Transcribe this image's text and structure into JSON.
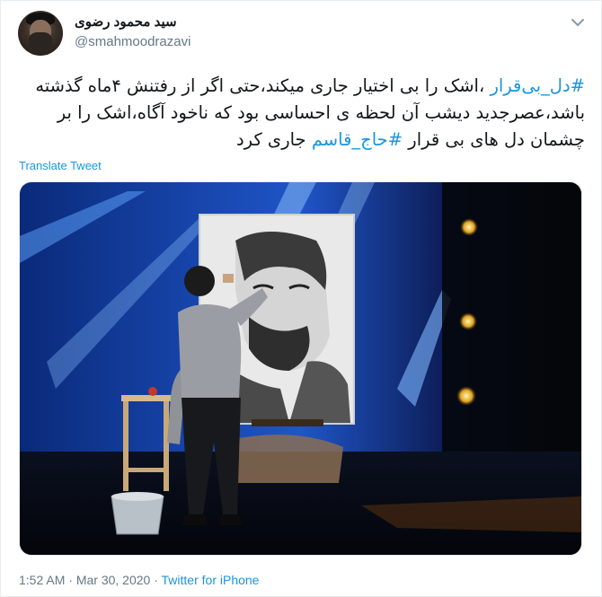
{
  "user": {
    "display_name": "سید محمود رضوی",
    "handle": "@smahmoodrazavi"
  },
  "tweet": {
    "hashtag1": "#دل_بی‌قرار",
    "part1": " ،اشک را بی اختیار جاری میکند،حتی اگر از رفتنش ۴ماه گذشته باشد،عصرجدید دیشب آن لحظه ی احساسی بود که ناخود آگاه،اشک را بر چشمان دل های بی قرار ",
    "hashtag2": "#حاج_قاسم",
    "part2": " جاری کرد"
  },
  "translate_label": "Translate Tweet",
  "meta": {
    "time": "1:52 AM",
    "sep": " · ",
    "date": "Mar 30, 2020",
    "source": "Twitter for iPhone"
  },
  "icons": {
    "menu": "chevron-down-icon"
  },
  "colors": {
    "link": "#1b95e0",
    "secondary_text": "#657786"
  }
}
